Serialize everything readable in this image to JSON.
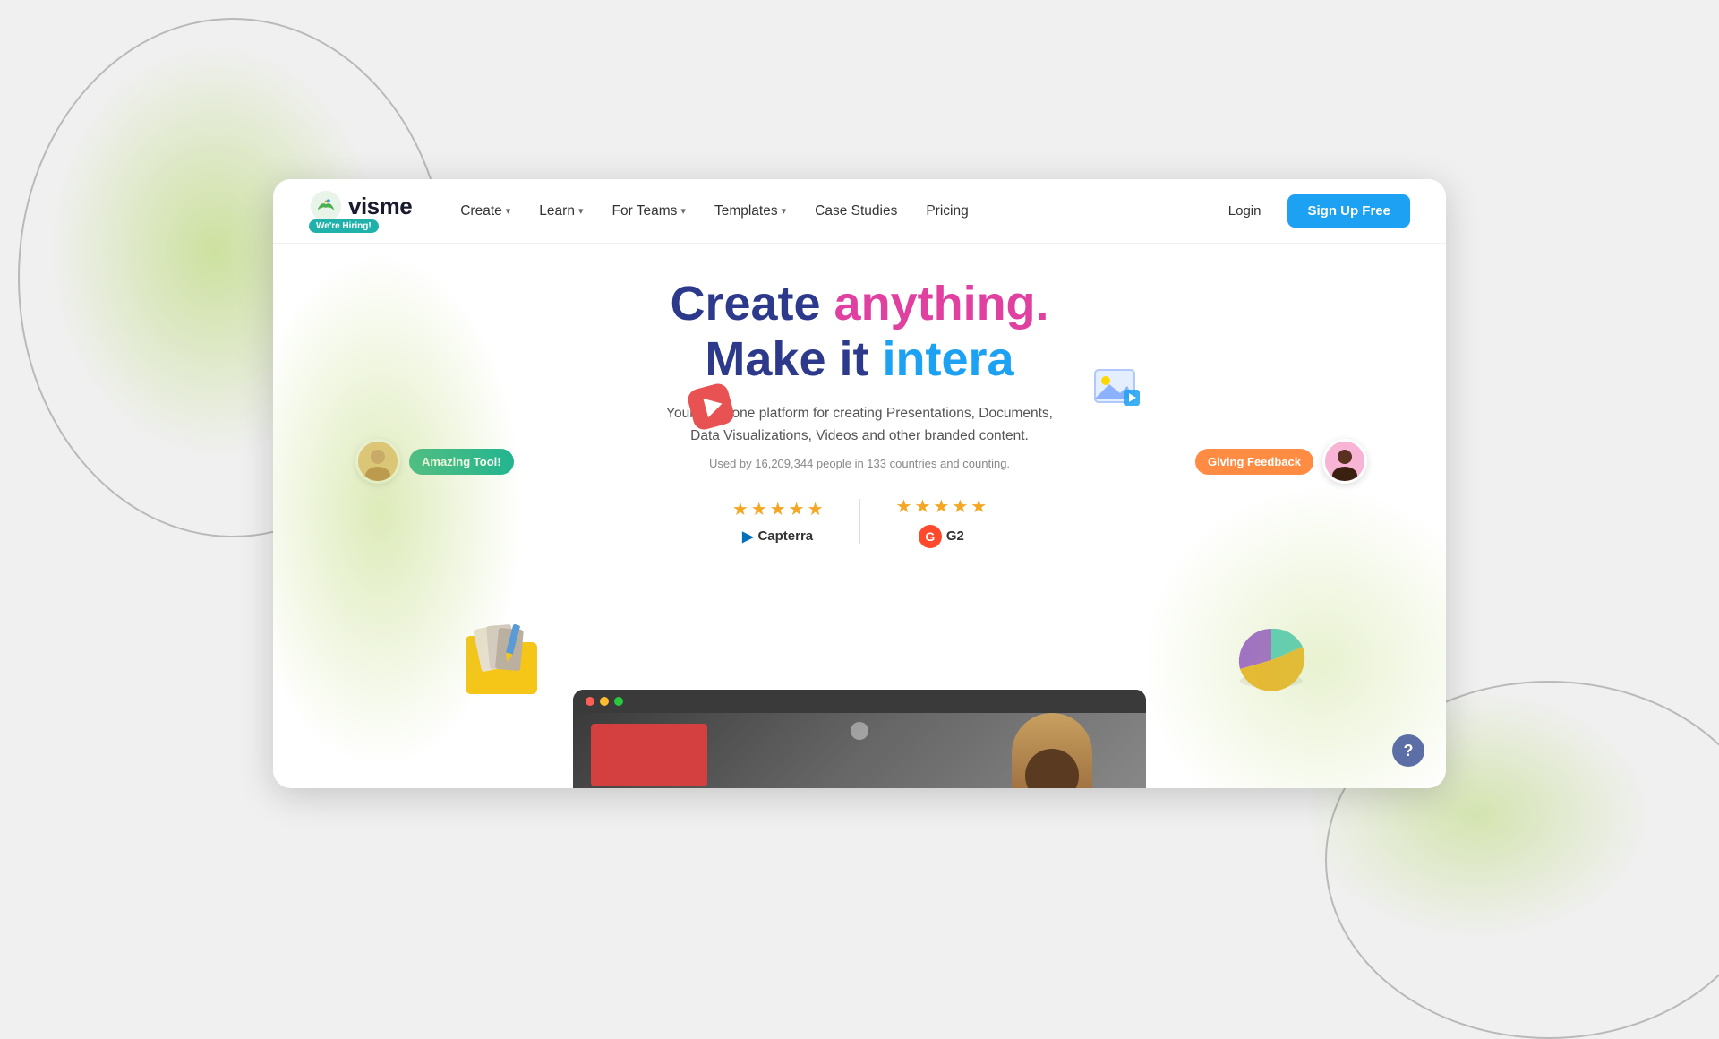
{
  "page": {
    "background": "#f0f0f0"
  },
  "navbar": {
    "logo_text": "visme",
    "hiring_badge": "We're Hiring!",
    "nav_items": [
      {
        "label": "Create",
        "has_dropdown": true
      },
      {
        "label": "Learn",
        "has_dropdown": true
      },
      {
        "label": "For Teams",
        "has_dropdown": true
      },
      {
        "label": "Templates",
        "has_dropdown": true
      },
      {
        "label": "Case Studies",
        "has_dropdown": false
      },
      {
        "label": "Pricing",
        "has_dropdown": false
      }
    ],
    "login_label": "Login",
    "signup_label": "Sign Up Free"
  },
  "hero": {
    "title_line1_part1": "Create ",
    "title_line1_part2": "anything.",
    "title_line2_part1": "Make it ",
    "title_line2_part2": "intera",
    "subtitle_line1": "Your all-in-one platform for creating Presentations, Documents,",
    "subtitle_line2": "Data Visualizations, Videos and other branded content.",
    "users_text": "Used by 16,209,344 people in 133 countries and counting."
  },
  "ratings": {
    "capterra": {
      "stars": 4.5,
      "label": "Capterra"
    },
    "g2": {
      "stars": 4.5,
      "label": "G2"
    }
  },
  "floating": {
    "bubble_left": "Amazing Tool!",
    "bubble_right": "Giving Feedback",
    "avatar_left_emoji": "😊",
    "avatar_right_emoji": "👩🏾"
  },
  "help": {
    "label": "?"
  }
}
